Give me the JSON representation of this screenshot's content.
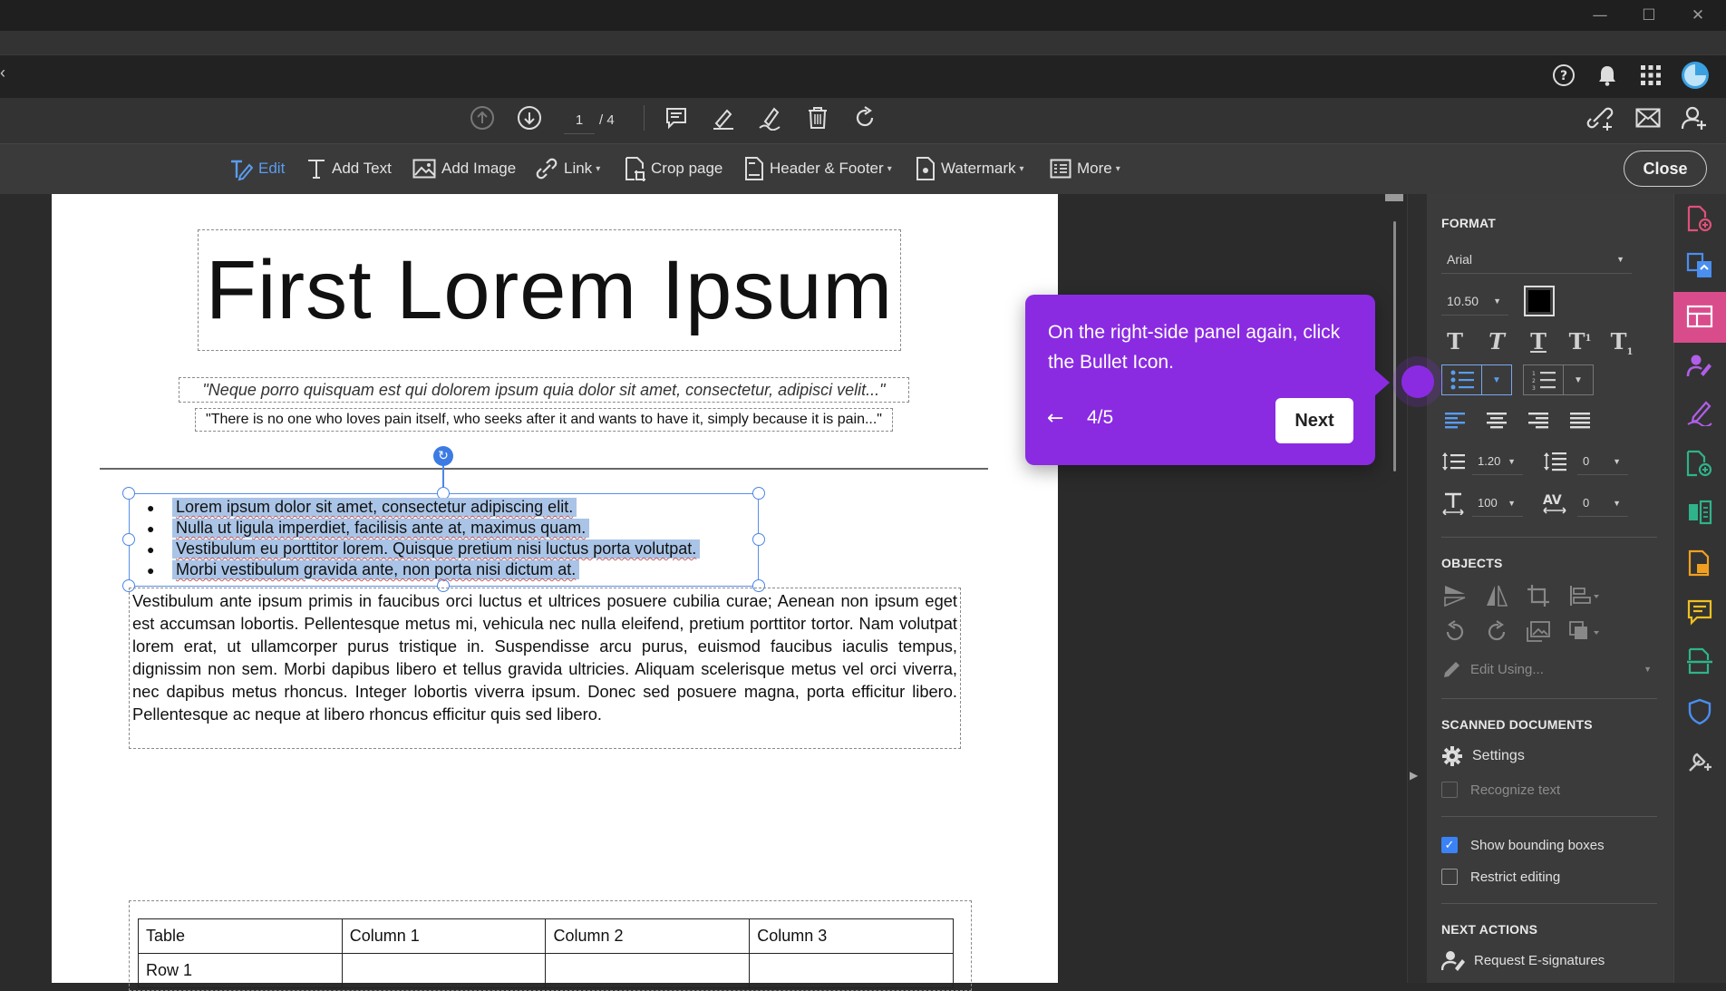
{
  "window": {
    "minimize": "—",
    "maximize": "☐",
    "close": "✕"
  },
  "tabbar": {
    "left_chevron": "‹"
  },
  "nav": {
    "page_current": "1",
    "page_total": "/ 4"
  },
  "edit_toolbar": {
    "edit": "Edit",
    "add_text": "Add Text",
    "add_image": "Add Image",
    "link": "Link",
    "crop_page": "Crop page",
    "header_footer": "Header & Footer",
    "watermark": "Watermark",
    "more": "More",
    "close": "Close"
  },
  "document": {
    "title": "First Lorem Ipsum",
    "quote1": "\"Neque porro quisquam est qui dolorem ipsum quia dolor sit amet, consectetur, adipisci velit...\"",
    "quote2": "\"There is no one who loves pain itself, who seeks after it and wants to have it, simply because it is pain...\"",
    "bullets": [
      "Lorem ipsum dolor sit amet, consectetur adipiscing elit.",
      "Nulla ut ligula imperdiet, facilisis ante at, maximus quam.",
      "Vestibulum eu porttitor lorem. Quisque pretium nisi luctus porta volutpat.",
      "Morbi vestibulum gravida ante, non porta nisi dictum at."
    ],
    "paragraph": "Vestibulum ante ipsum primis in faucibus orci luctus et ultrices posuere cubilia curae; Aenean non ipsum eget est accumsan lobortis. Pellentesque metus mi, vehicula nec nulla eleifend, pretium porttitor tortor. Nam volutpat lorem erat, ut ullamcorper purus tristique in. Suspendisse arcu purus, euismod faucibus iaculis tempus, dignissim non sem. Morbi dapibus libero et tellus gravida ultricies. Aliquam scelerisque metus vel orci viverra, nec dapibus metus rhoncus. Integer lobortis viverra ipsum. Donec sed posuere magna, porta efficitur libero. Pellentesque ac neque at libero rhoncus efficitur quis sed libero.",
    "table": {
      "header": [
        "Table",
        "Column 1",
        "Column 2",
        "Column 3"
      ],
      "row1": [
        "Row 1",
        "",
        "",
        ""
      ]
    }
  },
  "panel": {
    "format_title": "FORMAT",
    "font": "Arial",
    "font_size": "10.50",
    "text_color": "#000000",
    "line_spacing": "1.20",
    "para_spacing": "0",
    "horiz_scale": "100",
    "char_spacing": "0",
    "objects_title": "OBJECTS",
    "edit_using": "Edit Using...",
    "scanned_title": "SCANNED DOCUMENTS",
    "settings": "Settings",
    "recognize_text": "Recognize text",
    "show_bounding_boxes": "Show bounding boxes",
    "restrict_editing": "Restrict editing",
    "next_actions_title": "NEXT ACTIONS",
    "request_esign": "Request E-signatures"
  },
  "tooltip": {
    "text": "On the right-side panel again, click the Bullet Icon.",
    "step": "4/5",
    "next": "Next",
    "back": "←",
    "accent_color": "#8a2be2"
  },
  "colors": {
    "rail_active": "#d94c8c",
    "selection": "#a9c4e6",
    "edit_active": "#5a9cf0"
  }
}
